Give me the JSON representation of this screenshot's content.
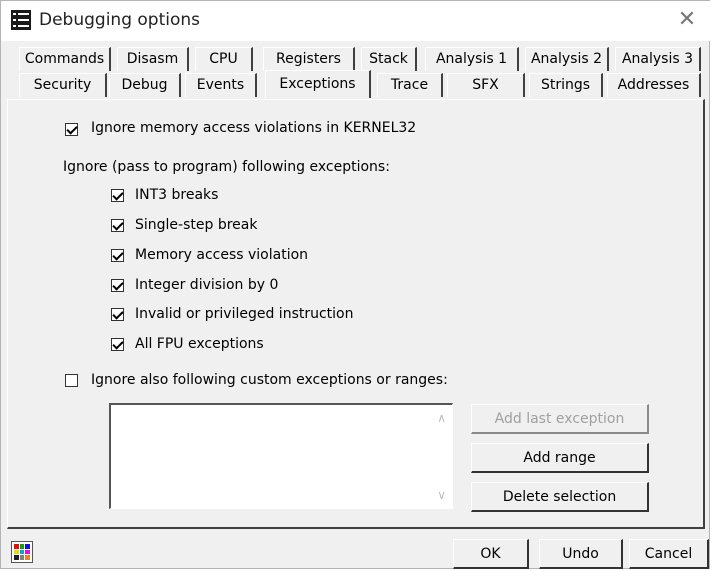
{
  "window": {
    "title": "Debugging options"
  },
  "tabs_row1": [
    "Commands",
    "Disasm",
    "CPU",
    "Registers",
    "Stack",
    "Analysis 1",
    "Analysis 2",
    "Analysis 3"
  ],
  "tabs_row2": [
    "Security",
    "Debug",
    "Events",
    "Exceptions",
    "Trace",
    "SFX",
    "Strings",
    "Addresses"
  ],
  "active_tab": "Exceptions",
  "options": {
    "ignore_kernel32": {
      "label": "Ignore memory access violations in KERNEL32",
      "checked": true
    },
    "ignore_heading": "Ignore (pass to program) following exceptions:",
    "exceptions": [
      {
        "label": "INT3 breaks",
        "checked": true
      },
      {
        "label": "Single-step break",
        "checked": true
      },
      {
        "label": "Memory access violation",
        "checked": true
      },
      {
        "label": "Integer division by 0",
        "checked": true
      },
      {
        "label": "Invalid or privileged instruction",
        "checked": true
      },
      {
        "label": "All FPU exceptions",
        "checked": true
      }
    ],
    "custom": {
      "label": "Ignore also following custom exceptions or ranges:",
      "checked": false
    }
  },
  "buttons": {
    "add_last": "Add last exception",
    "add_range": "Add range",
    "delete_selection": "Delete selection",
    "ok": "OK",
    "undo": "Undo",
    "cancel": "Cancel"
  },
  "icons": {
    "app": "list-icon",
    "close": "close-icon",
    "status": "color-grid-icon"
  }
}
